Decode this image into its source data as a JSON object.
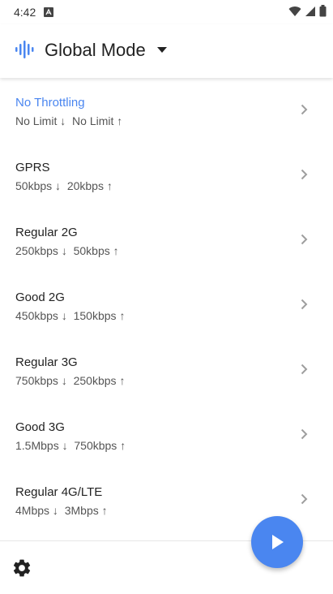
{
  "status_bar": {
    "time": "4:42",
    "notification_icon": "app-notification-icon",
    "icons": [
      "wifi-icon",
      "signal-icon",
      "battery-icon"
    ]
  },
  "header": {
    "logo_icon": "sound-wave-icon",
    "mode_title": "Global Mode",
    "dropdown_icon": "caret-down-icon"
  },
  "profiles": [
    {
      "name": "No Throttling",
      "down": "No Limit",
      "up": "No Limit",
      "active": true
    },
    {
      "name": "GPRS",
      "down": "50kbps",
      "up": "20kbps",
      "active": false
    },
    {
      "name": "Regular 2G",
      "down": "250kbps",
      "up": "50kbps",
      "active": false
    },
    {
      "name": "Good 2G",
      "down": "450kbps",
      "up": "150kbps",
      "active": false
    },
    {
      "name": "Regular 3G",
      "down": "750kbps",
      "up": "250kbps",
      "active": false
    },
    {
      "name": "Good 3G",
      "down": "1.5Mbps",
      "up": "750kbps",
      "active": false
    },
    {
      "name": "Regular 4G/LTE",
      "down": "4Mbps",
      "up": "3Mbps",
      "active": false
    }
  ],
  "arrows": {
    "down": "↓",
    "up": "↑"
  },
  "bottom": {
    "settings_icon": "gear-icon"
  },
  "fab": {
    "icon": "play-icon"
  },
  "colors": {
    "accent": "#4a86f0",
    "text": "#222222",
    "secondary_text": "#555555"
  }
}
